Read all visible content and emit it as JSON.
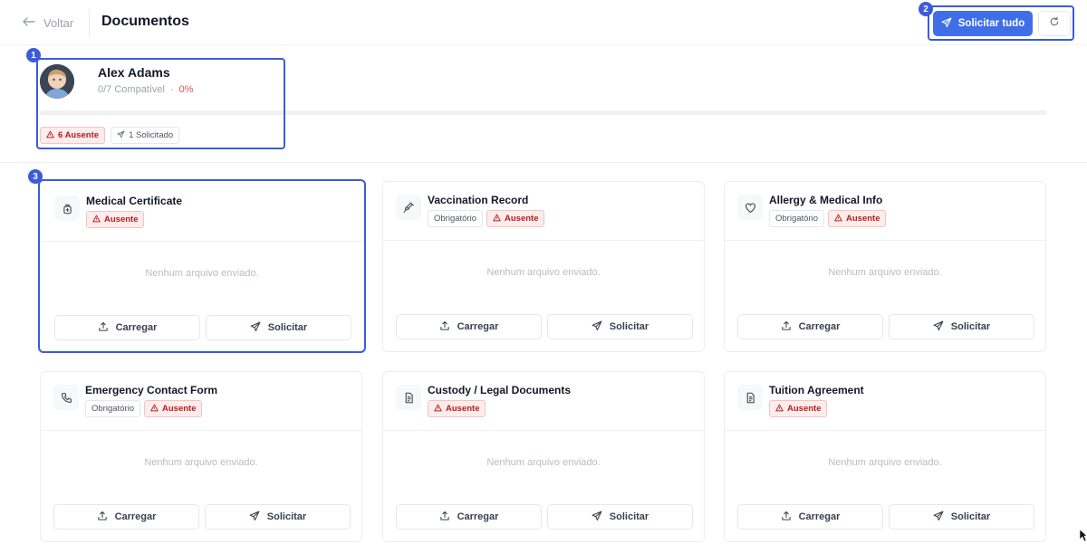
{
  "header": {
    "back_label": "Voltar",
    "title": "Documentos",
    "request_all_label": "Solicitar tudo"
  },
  "markers": [
    "1",
    "2",
    "3"
  ],
  "profile": {
    "name": "Alex Adams",
    "compat": "0/7 Compatível",
    "separator": "·",
    "percent": "0%",
    "progress": 0,
    "missing_pill": "6 Ausente",
    "requested_pill": "1 Solicitado"
  },
  "common": {
    "empty_text": "Nenhum arquivo enviado.",
    "upload_label": "Carregar",
    "request_label": "Solicitar",
    "required_tag": "Obrigatório",
    "missing_tag": "Ausente"
  },
  "documents": [
    {
      "title": "Medical Certificate",
      "icon": "medkit-icon",
      "required": false
    },
    {
      "title": "Vaccination Record",
      "icon": "syringe-icon",
      "required": true
    },
    {
      "title": "Allergy & Medical Info",
      "icon": "heart-icon",
      "required": true
    },
    {
      "title": "Emergency Contact Form",
      "icon": "phone-icon",
      "required": true
    },
    {
      "title": "Custody / Legal Documents",
      "icon": "document-icon",
      "required": false
    },
    {
      "title": "Tuition Agreement",
      "icon": "document-icon",
      "required": false
    }
  ],
  "colors": {
    "accent": "#3f6ee8",
    "highlight": "#3b5bdb",
    "danger": "#e05252"
  }
}
